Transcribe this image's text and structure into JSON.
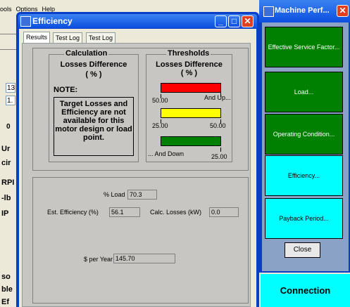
{
  "bg_app": {
    "menu": [
      "ools",
      "Options",
      "Help"
    ],
    "fields": [
      "13",
      "1.",
      "0"
    ],
    "labels": [
      "Ur",
      "cir",
      "RPI",
      "-lb",
      "IP",
      "so",
      "ble",
      "Ef"
    ]
  },
  "dialog": {
    "title": "Efficiency",
    "tabs": [
      "Results",
      "Test Log",
      "Test Log"
    ],
    "calculation": {
      "title": "Calculation",
      "heading": "Losses Difference",
      "unit": "( % )",
      "note_label": "NOTE:",
      "note_text": "Target Losses and Efficiency are not available for this motor design or load point."
    },
    "thresholds": {
      "title": "Thresholds",
      "heading": "Losses Difference",
      "unit": "( % )",
      "bars": [
        {
          "color": "#ff0000",
          "left_label": "50.00",
          "right_label": "And Up..."
        },
        {
          "color": "#ffff00",
          "left_label": "25.00",
          "right_label": "50.00"
        },
        {
          "color": "#008000",
          "left_label": "... And Down",
          "right_label": "25.00"
        }
      ]
    },
    "results": {
      "load_label": "% Load",
      "load_value": "70.3",
      "eff_label": "Est. Efficiency (%)",
      "eff_value": "56.1",
      "losses_label": "Calc. Losses (kW)",
      "losses_value": "0.0",
      "year_label": "$ per Year",
      "year_value": "145.70"
    }
  },
  "machine_perf": {
    "title": "Machine Perf...",
    "buttons": [
      {
        "label": "Effective Service Factor...",
        "style": "green"
      },
      {
        "label": "Load...",
        "style": "green"
      },
      {
        "label": "Operating Condition...",
        "style": "green"
      },
      {
        "label": "Efficiency...",
        "style": "cyan"
      },
      {
        "label": "Payback Period...",
        "style": "cyan"
      }
    ],
    "close_label": "Close"
  },
  "connection_label": "Connection"
}
